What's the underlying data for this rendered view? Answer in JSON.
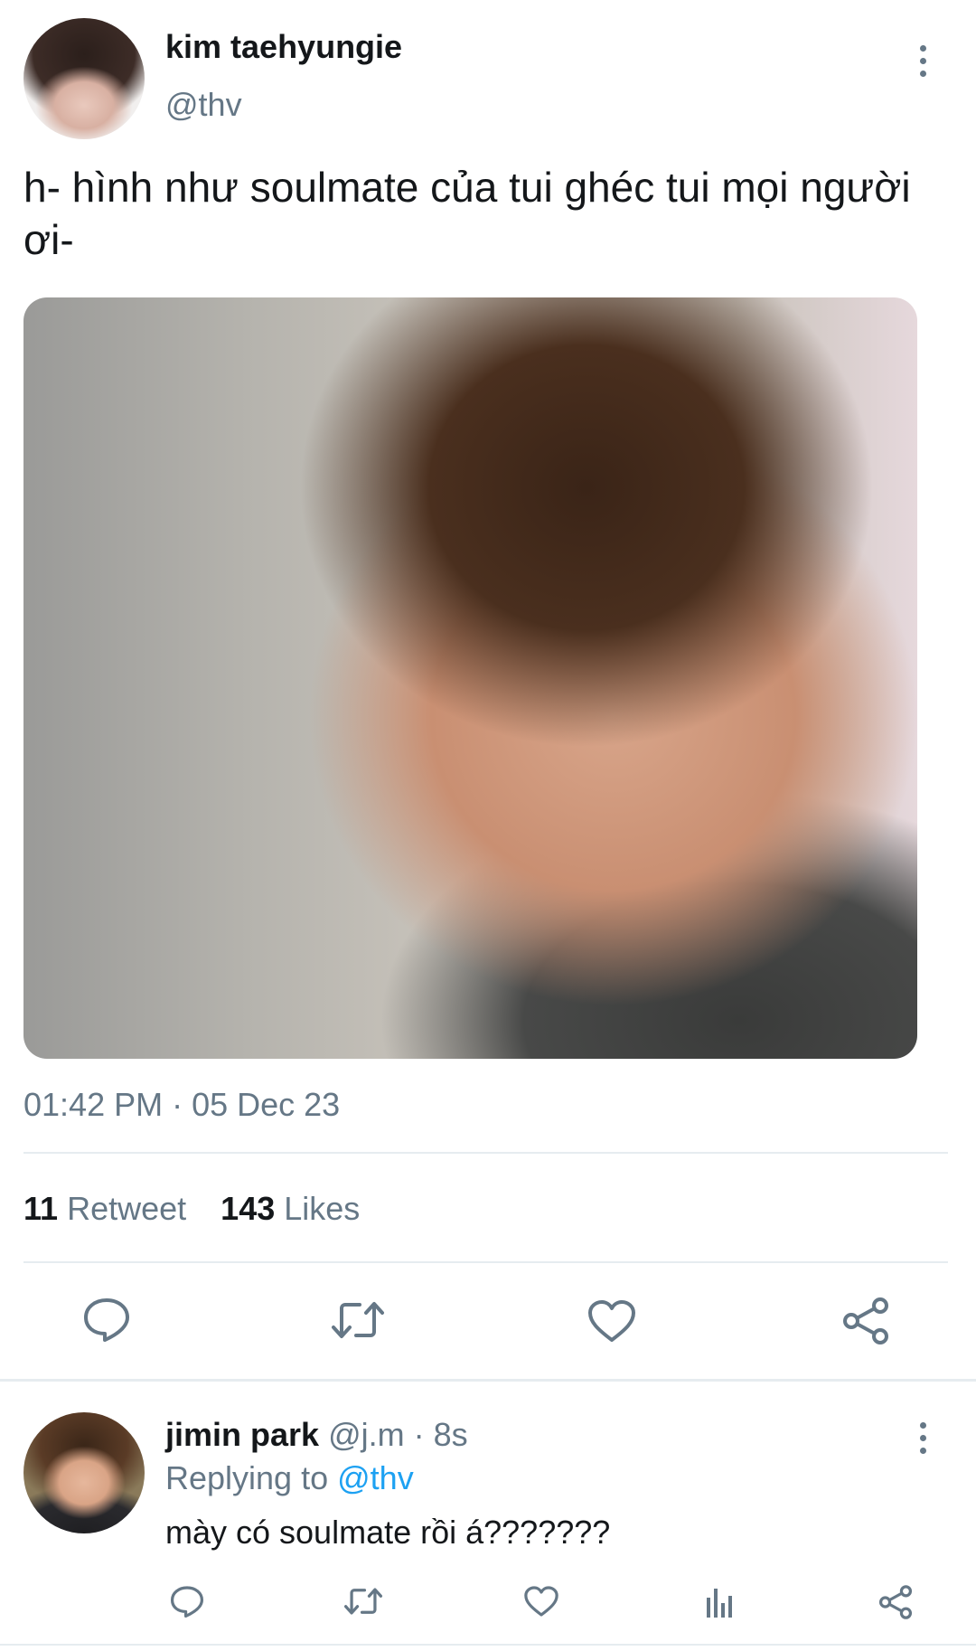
{
  "tweet": {
    "author_name": "kim taehyungie",
    "author_handle": "@thv",
    "text": "h- hình như soulmate của tui ghéc tui mọi người ơi-",
    "timestamp": "01:42 PM · 05 Dec 23",
    "retweet_count": "11",
    "retweet_label": "Retweet",
    "likes_count": "143",
    "likes_label": "Likes"
  },
  "reply": {
    "author_name": "jimin park",
    "meta": "@j.m · 8s",
    "replying_prefix": "Replying to",
    "replying_handle": "@thv",
    "text": "mày có soulmate rồi á???????"
  },
  "icons": {
    "tweet_actions": [
      "comment-icon",
      "retweet-icon",
      "heart-icon",
      "share-icon"
    ],
    "reply_actions": [
      "comment-icon",
      "retweet-icon",
      "heart-icon",
      "analytics-icon",
      "share-icon"
    ],
    "more": "more-vertical-icon"
  },
  "colors": {
    "text": "#14171a",
    "muted": "#657786",
    "link": "#1da1f2",
    "divider": "#e6ecf0"
  }
}
